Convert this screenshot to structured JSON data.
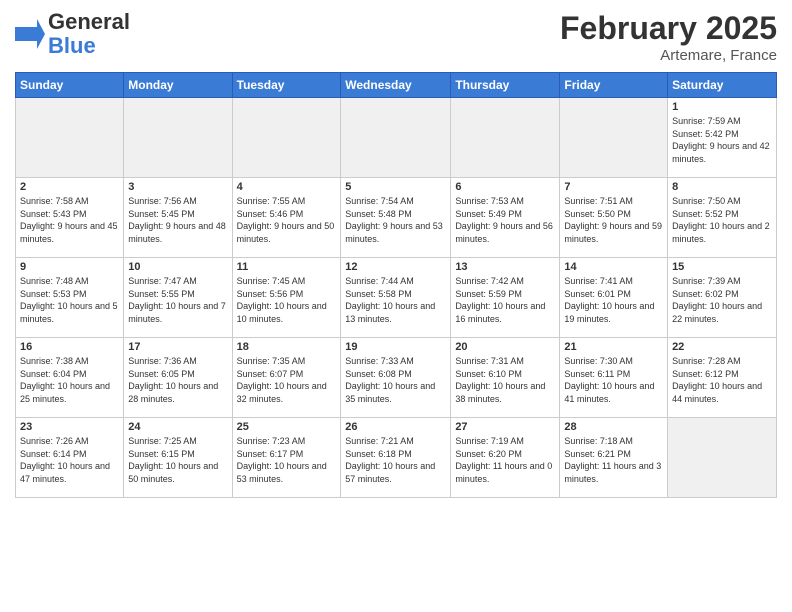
{
  "header": {
    "logo_line1": "General",
    "logo_line2": "Blue",
    "month_title": "February 2025",
    "subtitle": "Artemare, France"
  },
  "weekdays": [
    "Sunday",
    "Monday",
    "Tuesday",
    "Wednesday",
    "Thursday",
    "Friday",
    "Saturday"
  ],
  "days": [
    {
      "num": "",
      "info": ""
    },
    {
      "num": "",
      "info": ""
    },
    {
      "num": "",
      "info": ""
    },
    {
      "num": "",
      "info": ""
    },
    {
      "num": "",
      "info": ""
    },
    {
      "num": "",
      "info": ""
    },
    {
      "num": "1",
      "info": "Sunrise: 7:59 AM\nSunset: 5:42 PM\nDaylight: 9 hours and 42 minutes."
    },
    {
      "num": "2",
      "info": "Sunrise: 7:58 AM\nSunset: 5:43 PM\nDaylight: 9 hours and 45 minutes."
    },
    {
      "num": "3",
      "info": "Sunrise: 7:56 AM\nSunset: 5:45 PM\nDaylight: 9 hours and 48 minutes."
    },
    {
      "num": "4",
      "info": "Sunrise: 7:55 AM\nSunset: 5:46 PM\nDaylight: 9 hours and 50 minutes."
    },
    {
      "num": "5",
      "info": "Sunrise: 7:54 AM\nSunset: 5:48 PM\nDaylight: 9 hours and 53 minutes."
    },
    {
      "num": "6",
      "info": "Sunrise: 7:53 AM\nSunset: 5:49 PM\nDaylight: 9 hours and 56 minutes."
    },
    {
      "num": "7",
      "info": "Sunrise: 7:51 AM\nSunset: 5:50 PM\nDaylight: 9 hours and 59 minutes."
    },
    {
      "num": "8",
      "info": "Sunrise: 7:50 AM\nSunset: 5:52 PM\nDaylight: 10 hours and 2 minutes."
    },
    {
      "num": "9",
      "info": "Sunrise: 7:48 AM\nSunset: 5:53 PM\nDaylight: 10 hours and 5 minutes."
    },
    {
      "num": "10",
      "info": "Sunrise: 7:47 AM\nSunset: 5:55 PM\nDaylight: 10 hours and 7 minutes."
    },
    {
      "num": "11",
      "info": "Sunrise: 7:45 AM\nSunset: 5:56 PM\nDaylight: 10 hours and 10 minutes."
    },
    {
      "num": "12",
      "info": "Sunrise: 7:44 AM\nSunset: 5:58 PM\nDaylight: 10 hours and 13 minutes."
    },
    {
      "num": "13",
      "info": "Sunrise: 7:42 AM\nSunset: 5:59 PM\nDaylight: 10 hours and 16 minutes."
    },
    {
      "num": "14",
      "info": "Sunrise: 7:41 AM\nSunset: 6:01 PM\nDaylight: 10 hours and 19 minutes."
    },
    {
      "num": "15",
      "info": "Sunrise: 7:39 AM\nSunset: 6:02 PM\nDaylight: 10 hours and 22 minutes."
    },
    {
      "num": "16",
      "info": "Sunrise: 7:38 AM\nSunset: 6:04 PM\nDaylight: 10 hours and 25 minutes."
    },
    {
      "num": "17",
      "info": "Sunrise: 7:36 AM\nSunset: 6:05 PM\nDaylight: 10 hours and 28 minutes."
    },
    {
      "num": "18",
      "info": "Sunrise: 7:35 AM\nSunset: 6:07 PM\nDaylight: 10 hours and 32 minutes."
    },
    {
      "num": "19",
      "info": "Sunrise: 7:33 AM\nSunset: 6:08 PM\nDaylight: 10 hours and 35 minutes."
    },
    {
      "num": "20",
      "info": "Sunrise: 7:31 AM\nSunset: 6:10 PM\nDaylight: 10 hours and 38 minutes."
    },
    {
      "num": "21",
      "info": "Sunrise: 7:30 AM\nSunset: 6:11 PM\nDaylight: 10 hours and 41 minutes."
    },
    {
      "num": "22",
      "info": "Sunrise: 7:28 AM\nSunset: 6:12 PM\nDaylight: 10 hours and 44 minutes."
    },
    {
      "num": "23",
      "info": "Sunrise: 7:26 AM\nSunset: 6:14 PM\nDaylight: 10 hours and 47 minutes."
    },
    {
      "num": "24",
      "info": "Sunrise: 7:25 AM\nSunset: 6:15 PM\nDaylight: 10 hours and 50 minutes."
    },
    {
      "num": "25",
      "info": "Sunrise: 7:23 AM\nSunset: 6:17 PM\nDaylight: 10 hours and 53 minutes."
    },
    {
      "num": "26",
      "info": "Sunrise: 7:21 AM\nSunset: 6:18 PM\nDaylight: 10 hours and 57 minutes."
    },
    {
      "num": "27",
      "info": "Sunrise: 7:19 AM\nSunset: 6:20 PM\nDaylight: 11 hours and 0 minutes."
    },
    {
      "num": "28",
      "info": "Sunrise: 7:18 AM\nSunset: 6:21 PM\nDaylight: 11 hours and 3 minutes."
    },
    {
      "num": "",
      "info": ""
    }
  ]
}
